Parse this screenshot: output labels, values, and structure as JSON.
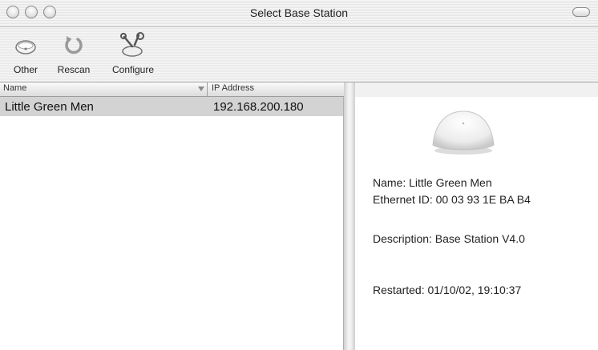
{
  "window": {
    "title": "Select Base Station"
  },
  "toolbar": {
    "items": [
      {
        "label": "Other",
        "icon": "airport-disc-icon"
      },
      {
        "label": "Rescan",
        "icon": "rescan-icon"
      },
      {
        "label": "Configure",
        "icon": "configure-icon"
      }
    ]
  },
  "list": {
    "columns": [
      "Name",
      "IP Address"
    ],
    "rows": [
      {
        "name": "Little Green Men",
        "ip": "192.168.200.180",
        "selected": true
      }
    ]
  },
  "detail": {
    "image": "base-station-icon",
    "name_line": "Name:  Little Green Men",
    "ethernet_line": "Ethernet ID:  00 03 93 1E BA B4",
    "description_line": "Description:  Base Station V4.0",
    "restarted_line": "Restarted:  01/10/02, 19:10:37"
  }
}
